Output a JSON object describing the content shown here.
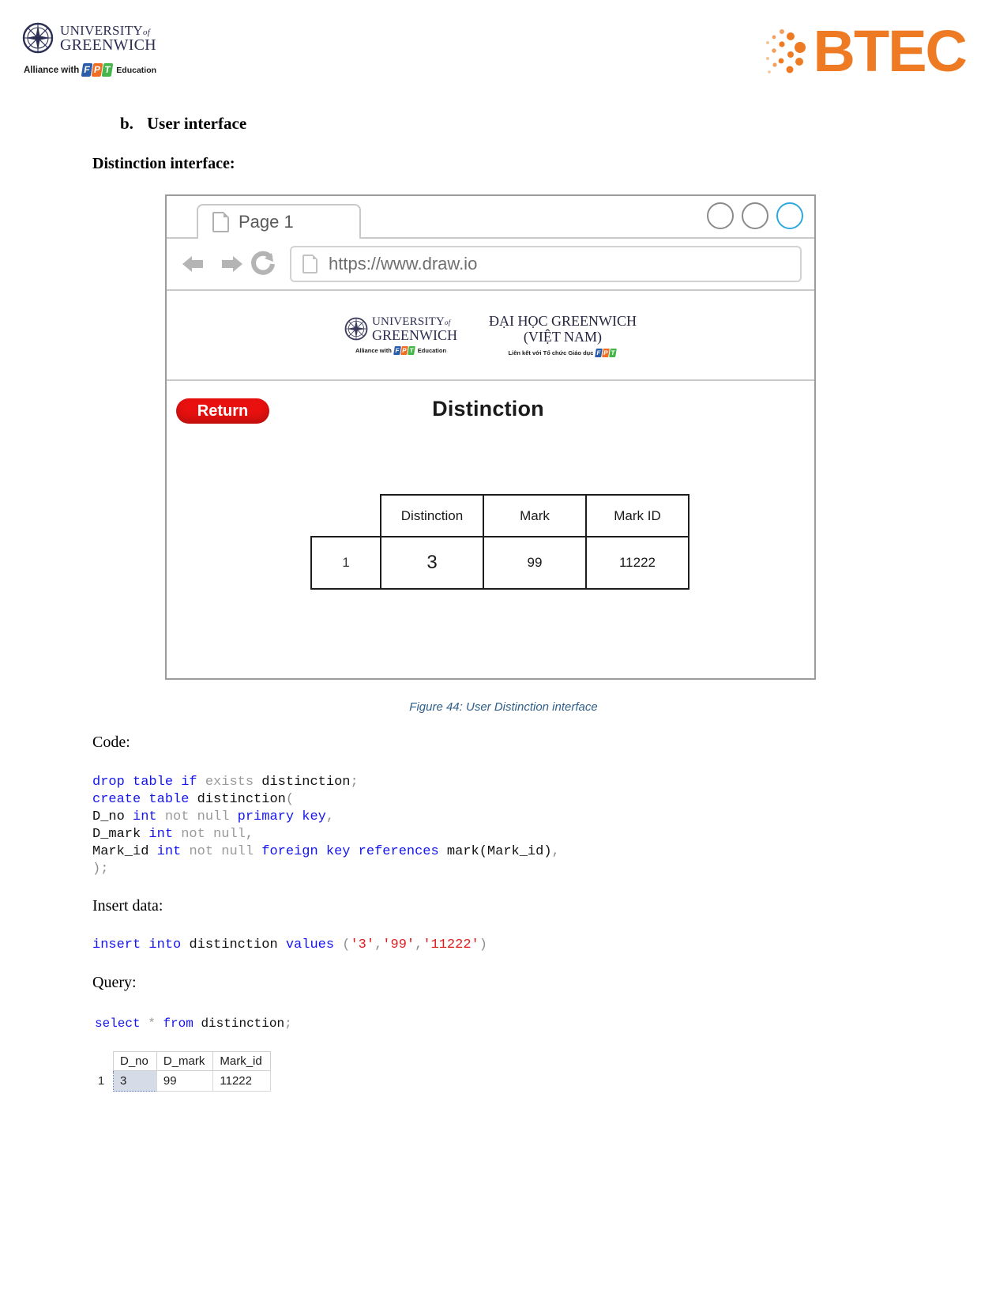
{
  "page_header": {
    "university_logo": {
      "icon": "compass-rose-icon",
      "line1": "UNIVERSITY",
      "line1_suffix": "of",
      "line2": "GREENWICH",
      "alliance_prefix": "Alliance with",
      "alliance_brand": [
        "F",
        "P",
        "T"
      ],
      "alliance_suffix": "Education"
    },
    "btec_logo": {
      "text": "BTEC",
      "color": "#ee7b23",
      "icon": "btec-dots-icon"
    }
  },
  "body": {
    "heading_letter": "b.",
    "heading_text": "User interface",
    "sub_heading": "Distinction interface:"
  },
  "mockup": {
    "tab": {
      "label": "Page 1",
      "icon": "document-icon"
    },
    "window_controls": [
      "minimize-circle",
      "maximize-circle",
      "close-circle"
    ],
    "accent_circle_color": "#2fa8e0",
    "nav": {
      "back": "back-arrow-icon",
      "forward": "forward-arrow-icon",
      "reload": "reload-icon"
    },
    "url": "https://www.draw.io",
    "site_header": {
      "left_logo": {
        "line1": "UNIVERSITY",
        "line1_suffix": "of",
        "line2": "GREENWICH",
        "alliance_prefix": "Alliance with",
        "alliance_brand": [
          "F",
          "P",
          "T"
        ],
        "alliance_suffix": "Education"
      },
      "right_logo": {
        "line1": "ĐẠI HỌC GREENWICH",
        "line2": "(VIỆT NAM)",
        "alliance_prefix": "Liên kết với Tổ chức Giáo dục",
        "alliance_brand": [
          "F",
          "P",
          "T"
        ]
      }
    },
    "return_button": "Return",
    "content_title": "Distinction",
    "table": {
      "headers": [
        "",
        "Distinction",
        "Mark",
        "Mark ID"
      ],
      "rows": [
        [
          "1",
          "3",
          "99",
          "11222"
        ]
      ]
    }
  },
  "figure_caption": "Figure 44: User Distinction interface",
  "labels": {
    "code": "Code:",
    "insert": "Insert data:",
    "query": "Query:"
  },
  "code": {
    "create": {
      "l1_k1": "drop",
      "l1_k2": "table",
      "l1_k3": "if",
      "l1_dim": "exists",
      "l1_id": "distinction",
      "l1_semi": ";",
      "l2_k1": "create",
      "l2_k2": "table",
      "l2_id": "distinction",
      "l2_paren": "(",
      "l3_id": "D_no",
      "l3_type": "int",
      "l3_dim": "not null",
      "l3_k": "primary key",
      "l3_comma": ",",
      "l4_id": "D_mark",
      "l4_type": "int",
      "l4_dim": "not null",
      "l4_comma": ",",
      "l5_id": "Mark_id",
      "l5_type": "int",
      "l5_dim": "not null",
      "l5_k": "foreign key references",
      "l5_ref": "mark(Mark_id)",
      "l5_comma": ",",
      "l6": ");"
    },
    "insert": {
      "k1": "insert",
      "k2": "into",
      "id": "distinction",
      "k3": "values",
      "open": "(",
      "v1": "'3'",
      "c1": ",",
      "v2": "'99'",
      "c2": ",",
      "v3": "'11222'",
      "close": ")"
    },
    "query": {
      "k1": "select",
      "star": "*",
      "k2": "from",
      "id": "distinction",
      "semi": ";"
    }
  },
  "result_grid": {
    "headers": [
      "D_no",
      "D_mark",
      "Mark_id"
    ],
    "row_number": "1",
    "rows": [
      [
        "3",
        "99",
        "11222"
      ]
    ],
    "selected_cell": "3",
    "selected_bg": "#d6dbe8"
  }
}
